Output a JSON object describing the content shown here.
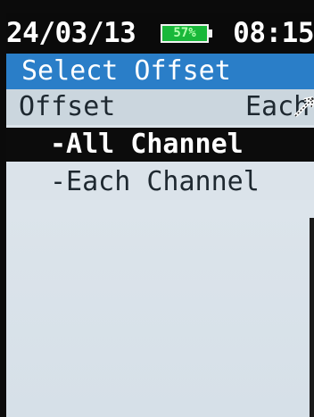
{
  "status": {
    "date": "24/03/13",
    "battery_percent": "57%",
    "time": "08:15"
  },
  "menu": {
    "title": "Select Offset",
    "current_setting": {
      "label": "Offset",
      "value": "Each"
    },
    "options": [
      {
        "label": "-All Channel",
        "selected": true
      },
      {
        "label": "-Each Channel",
        "selected": false
      }
    ]
  },
  "colors": {
    "title_bar": "#2a7ec8",
    "status_bar": "#0a0a0a",
    "battery": "#19b83a",
    "screen_bg": "#dbe3ea",
    "selected_bg": "#0c0c0c"
  },
  "icons": {
    "battery": "battery-icon",
    "cursor": "cursor-arrow-icon"
  }
}
